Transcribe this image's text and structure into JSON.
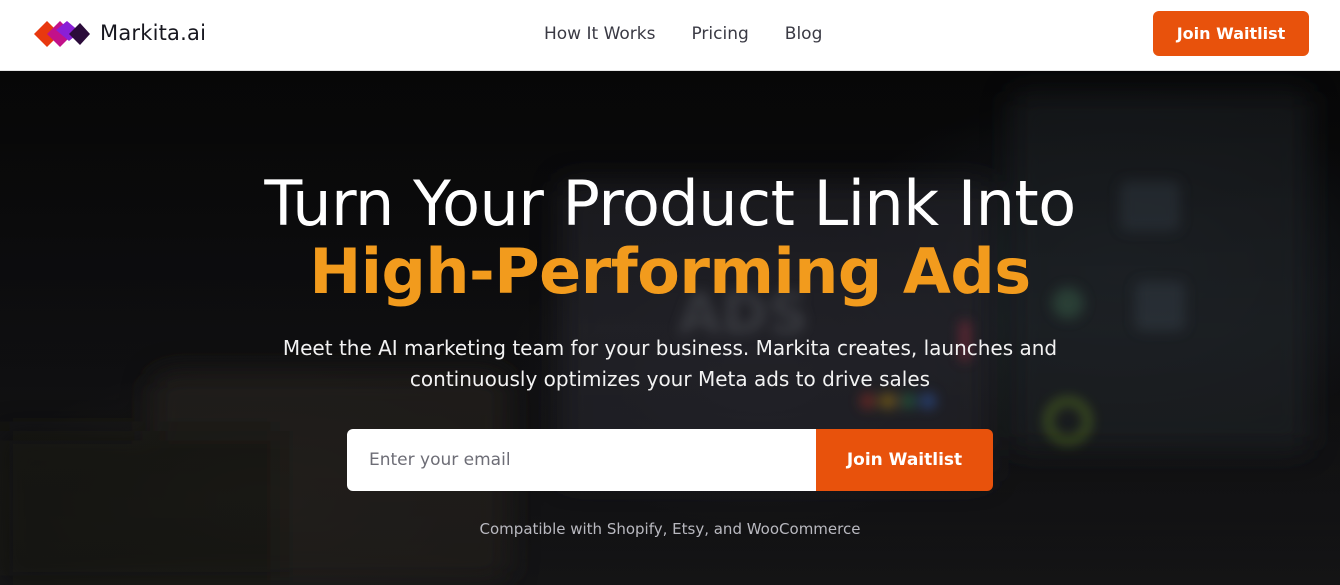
{
  "header": {
    "brand_name": "Markita.ai",
    "logo_icon": "markita-logo-icon",
    "nav": [
      {
        "label": "How It Works"
      },
      {
        "label": "Pricing"
      },
      {
        "label": "Blog"
      }
    ],
    "cta_label": "Join Waitlist"
  },
  "hero": {
    "headline": "Turn Your Product Link Into",
    "headline_accent": "High-Performing Ads",
    "subtext": "Meet the AI marketing team for your business. Markita creates, launches and continuously optimizes your Meta ads to drive sales",
    "email_placeholder": "Enter your email",
    "email_value": "",
    "signup_button": "Join Waitlist",
    "compat_note": "Compatible with Shopify, Etsy, and WooCommerce",
    "background_image": "blurred-laptop-ads-dashboard"
  },
  "colors": {
    "accent": "#e8520c",
    "headline_accent": "#f29b1d",
    "logo_red": "#e8380f",
    "logo_purple": "#8a1fd6",
    "logo_dark": "#2b0b3a",
    "header_bg": "#ffffff"
  }
}
